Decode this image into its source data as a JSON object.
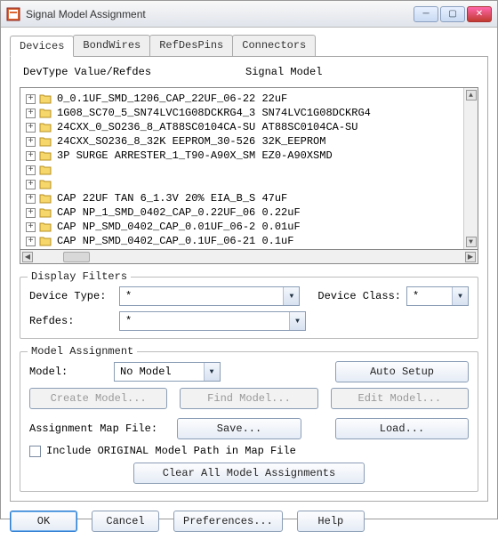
{
  "window": {
    "title": "Signal Model Assignment"
  },
  "tabs": [
    {
      "label": "Devices",
      "active": true
    },
    {
      "label": "BondWires"
    },
    {
      "label": "RefDesPins"
    },
    {
      "label": "Connectors"
    }
  ],
  "listHeader": {
    "col1": "DevType Value/Refdes",
    "col2": "Signal Model"
  },
  "devices": [
    {
      "text": "0_0.1UF_SMD_1206_CAP_22UF_06-22 22uF"
    },
    {
      "text": "1G08_SC70_5_SN74LVC1G08DCKRG4_3 SN74LVC1G08DCKRG4"
    },
    {
      "text": "24CXX_0_SO236_8_AT88SC0104CA-SU AT88SC0104CA-SU"
    },
    {
      "text": "24CXX_SO236_8_32K EEPROM_30-526 32K_EEPROM"
    },
    {
      "text": "3P SURGE ARRESTER_1_T90-A90X_SM EZ0-A90XSMD"
    },
    {
      "text": ""
    },
    {
      "text": ""
    },
    {
      "text": "CAP 22UF TAN 6_1.3V 20% EIA_B_S 47uF"
    },
    {
      "text": "CAP NP_1_SMD_0402_CAP_0.22UF_06 0.22uF"
    },
    {
      "text": "CAP NP_SMD_0402_CAP_0.01UF_06-2 0.01uF"
    },
    {
      "text": "CAP NP_SMD_0402_CAP_0.1UF_06-21 0.1uF"
    }
  ],
  "filters": {
    "legend": "Display Filters",
    "deviceTypeLabel": "Device Type:",
    "deviceTypeValue": "*",
    "deviceClassLabel": "Device Class:",
    "deviceClassValue": "*",
    "refdesLabel": "Refdes:",
    "refdesValue": "*"
  },
  "assignment": {
    "legend": "Model Assignment",
    "modelLabel": "Model:",
    "modelValue": "No Model",
    "autoSetup": "Auto Setup",
    "createModel": "Create Model...",
    "findModel": "Find Model...",
    "editModel": "Edit Model...",
    "mapFileLabel": "Assignment Map File:",
    "save": "Save...",
    "load": "Load...",
    "includeOriginal": "Include ORIGINAL Model Path in Map File",
    "clearAll": "Clear All Model Assignments"
  },
  "buttons": {
    "ok": "OK",
    "cancel": "Cancel",
    "preferences": "Preferences...",
    "help": "Help"
  }
}
